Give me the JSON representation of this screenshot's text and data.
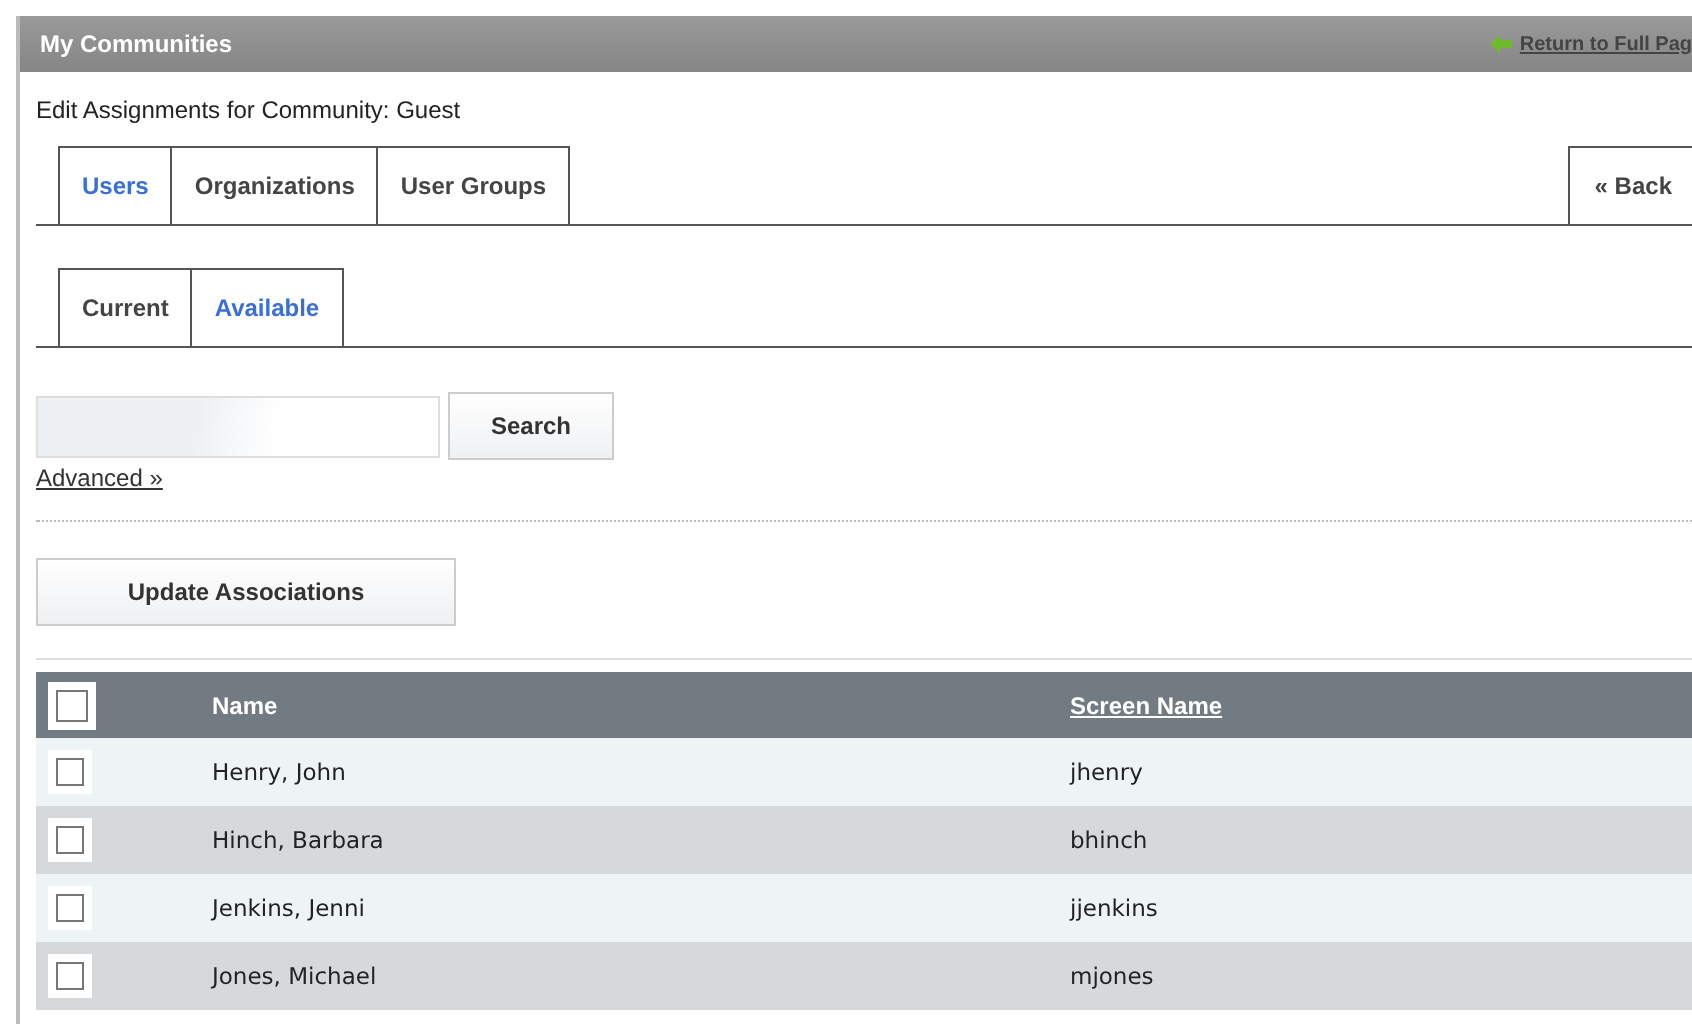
{
  "portlet": {
    "title": "My Communities",
    "return_link": "Return to Full Pag"
  },
  "heading": "Edit Assignments for Community: Guest",
  "tabs": [
    {
      "label": "Users",
      "selected": true
    },
    {
      "label": "Organizations",
      "selected": false
    },
    {
      "label": "User Groups",
      "selected": false
    }
  ],
  "back_link": "« Back",
  "subtabs": [
    {
      "label": "Current",
      "selected": false
    },
    {
      "label": "Available",
      "selected": true
    }
  ],
  "search": {
    "button": "Search",
    "advanced": "Advanced »"
  },
  "update_button": "Update Associations",
  "table": {
    "all_checked": false,
    "columns": [
      "Name",
      "Screen Name"
    ],
    "rows": [
      {
        "name": "Henry, John",
        "screen_name": "jhenry",
        "checked": false
      },
      {
        "name": "Hinch, Barbara",
        "screen_name": "bhinch",
        "checked": false
      },
      {
        "name": "Jenkins, Jenni",
        "screen_name": "jjenkins",
        "checked": false
      },
      {
        "name": "Jones, Michael",
        "screen_name": "mjones",
        "checked": false
      }
    ]
  }
}
